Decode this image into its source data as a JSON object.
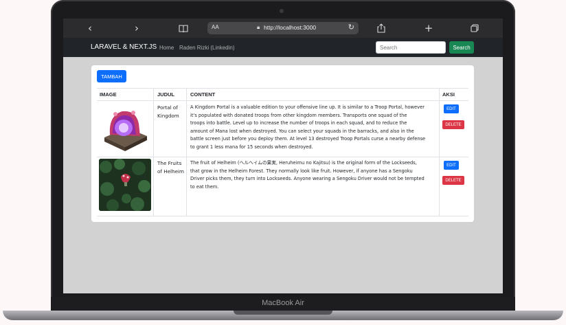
{
  "device": {
    "label": "MacBook Air"
  },
  "browser": {
    "text_size_label": "AA",
    "url": "http://localhost:3000",
    "icons": [
      "back-icon",
      "forward-icon",
      "book-icon",
      "lock-icon",
      "reload-icon",
      "share-icon",
      "plus-icon",
      "tabs-icon"
    ]
  },
  "navbar": {
    "brand": "LARAVEL & NEXT.JS",
    "links": [
      "Home",
      "Raden Rizki (Linkedin)"
    ],
    "search_placeholder": "Search",
    "search_button": "Search"
  },
  "card": {
    "add_button": "TAMBAH",
    "columns": [
      "IMAGE",
      "JUDUL",
      "CONTENT",
      "AKSI"
    ],
    "rows": [
      {
        "image": "portal-thumbnail",
        "title_lines": [
          "Portal of",
          "Kingdom"
        ],
        "content_lines": [
          "A Kingdom Portal is a valuable edition to your offensive line up. It is similar to a Troop Portal, however",
          "it's populated with donated troops from other kingdom members. Transports one squad of the",
          "troops into battle. Level up to increase the number of troops in each squad, and to reduce the",
          "amount of Mana lost when destroyed. You can select your squads in the barracks, and also in the",
          "battle screen just before you deploy them. At level 13 destroyed Troop Portals curse a nearby defense",
          "to grant 1 less mana for 15 seconds when destroyed."
        ],
        "edit": "EDIT",
        "delete": "DELETE"
      },
      {
        "image": "helheim-fruit-thumbnail",
        "title_lines": [
          "The Fruits",
          "of Helheim"
        ],
        "content_lines": [
          "The fruit of Helheim (ヘルヘイムの果実, Heruheimu no Kajitsu) is the original form of the Lockseeds,",
          "that grow in the Helheim Forest. They normally look like fruit. However, if anyone has a Sengoku",
          "Driver picks them, they turn into Lockseeds. Anyone wearing a Sengoku Driver would not be tempted",
          "to eat them."
        ],
        "edit": "EDIT",
        "delete": "DELETE"
      }
    ]
  },
  "colors": {
    "navbar": "#212529",
    "primary": "#0d6efd",
    "danger": "#dc3545",
    "success": "#198754",
    "page_bg": "#d2d2d2"
  }
}
